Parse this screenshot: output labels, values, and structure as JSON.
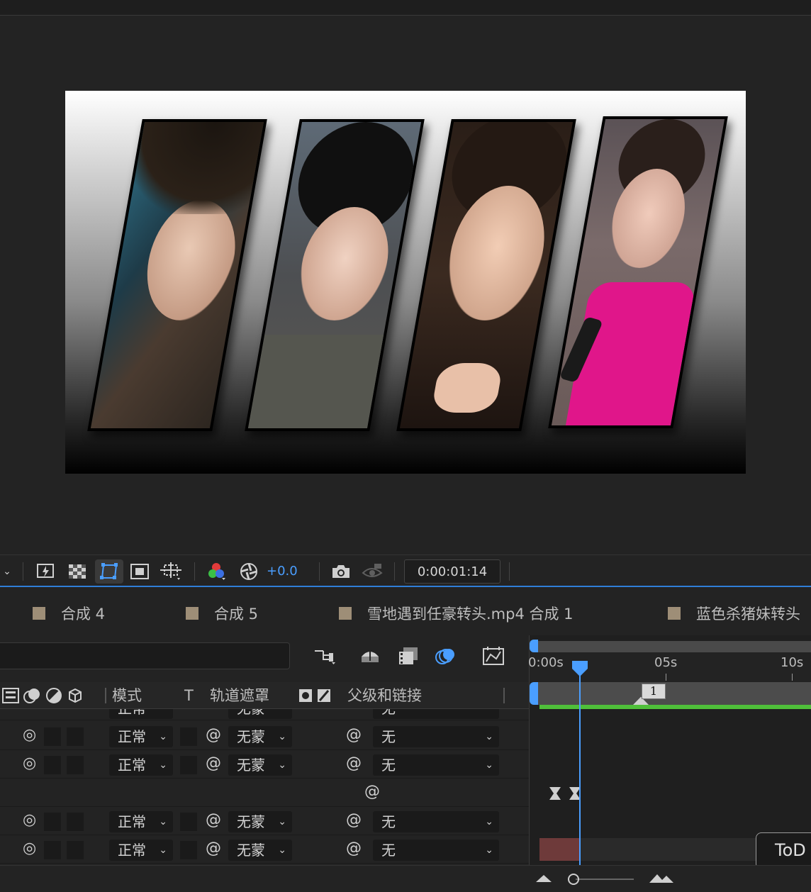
{
  "toolbar": {
    "exposure": "+0.0",
    "timecode": "0:00:01:14",
    "icons": [
      "fast-preview-icon",
      "transparency-grid-icon",
      "mask-path-icon",
      "region-of-interest-icon",
      "guides-icon",
      "color-channels-icon",
      "exposure-reset-icon",
      "snapshot-camera-icon",
      "show-snapshot-icon"
    ]
  },
  "tabs": [
    {
      "label": "合成 4",
      "color": "#9e8e77"
    },
    {
      "label": "合成 5",
      "color": "#9e8e77"
    },
    {
      "label": "雪地遇到任豪转头.mp4 合成 1",
      "color": "#9e8e77"
    },
    {
      "label": "蓝色杀猪妹转头",
      "color": "#9e8e77"
    }
  ],
  "columns": {
    "mode": "模式",
    "t": "T",
    "track_matte": "轨道遮罩",
    "parent": "父级和链接"
  },
  "layers": [
    {
      "mode": "正常",
      "matte": "无蒙",
      "parent": "无"
    },
    {
      "mode": "正常",
      "matte": "无蒙",
      "parent": "无"
    },
    {
      "mode": "正常",
      "matte": "无蒙",
      "parent": "无"
    },
    {
      "mode": "正常",
      "matte": "无蒙",
      "parent": "无"
    },
    {
      "mode": "正常",
      "matte": "无蒙",
      "parent": "无"
    }
  ],
  "partial_row": {
    "mode": "正常",
    "matte": "无蒙",
    "parent": "无"
  },
  "ruler": {
    "t0": "0:00s",
    "t1": "05s",
    "t2": "10s"
  },
  "marker_label": "1",
  "tooltip": "ToD",
  "colors": {
    "accent": "#4a9eff",
    "layer_bar": "#6e675b",
    "red_bar": "#6e3a3a",
    "green": "#4fbf3a"
  }
}
